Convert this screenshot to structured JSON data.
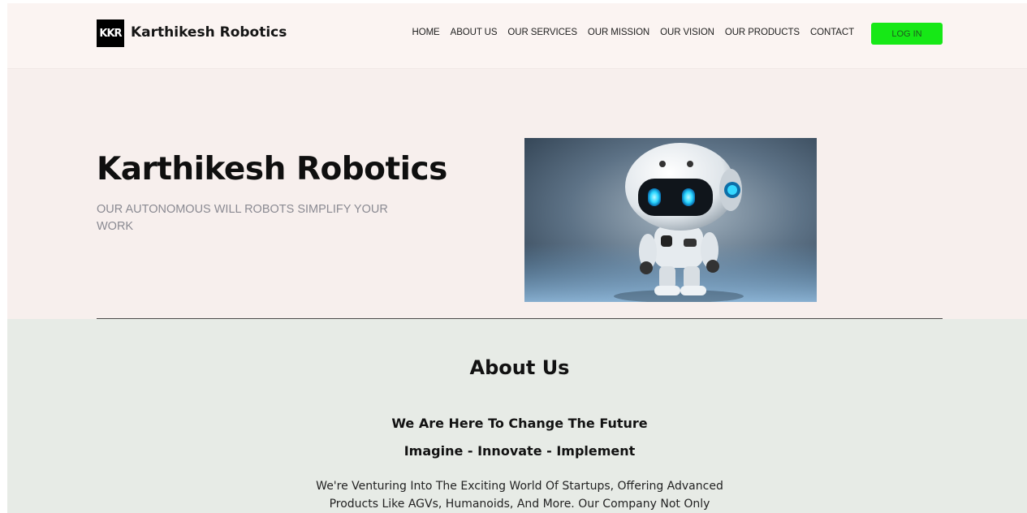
{
  "header": {
    "logo_text": "KKR",
    "brand": "Karthikesh Robotics",
    "nav": [
      "HOME",
      "ABOUT US",
      "OUR SERVICES",
      "OUR MISSION",
      "OUR VISION",
      "OUR PRODUCTS",
      "CONTACT"
    ],
    "login_label": "LOG IN",
    "login_color": "#16e816"
  },
  "hero": {
    "title": "Karthikesh Robotics",
    "subtitle": "OUR AUTONOMOUS WILL ROBOTS SIMPLIFY YOUR WORK",
    "image": "robot-illustration"
  },
  "about": {
    "title": "About Us",
    "tagline1": "We Are Here To Change The Future",
    "tagline2": "Imagine - Innovate - Implement",
    "body": "We're Venturing Into The Exciting World Of Startups, Offering Advanced Products Like AGVs, Humanoids, And More. Our Company Not Only"
  }
}
